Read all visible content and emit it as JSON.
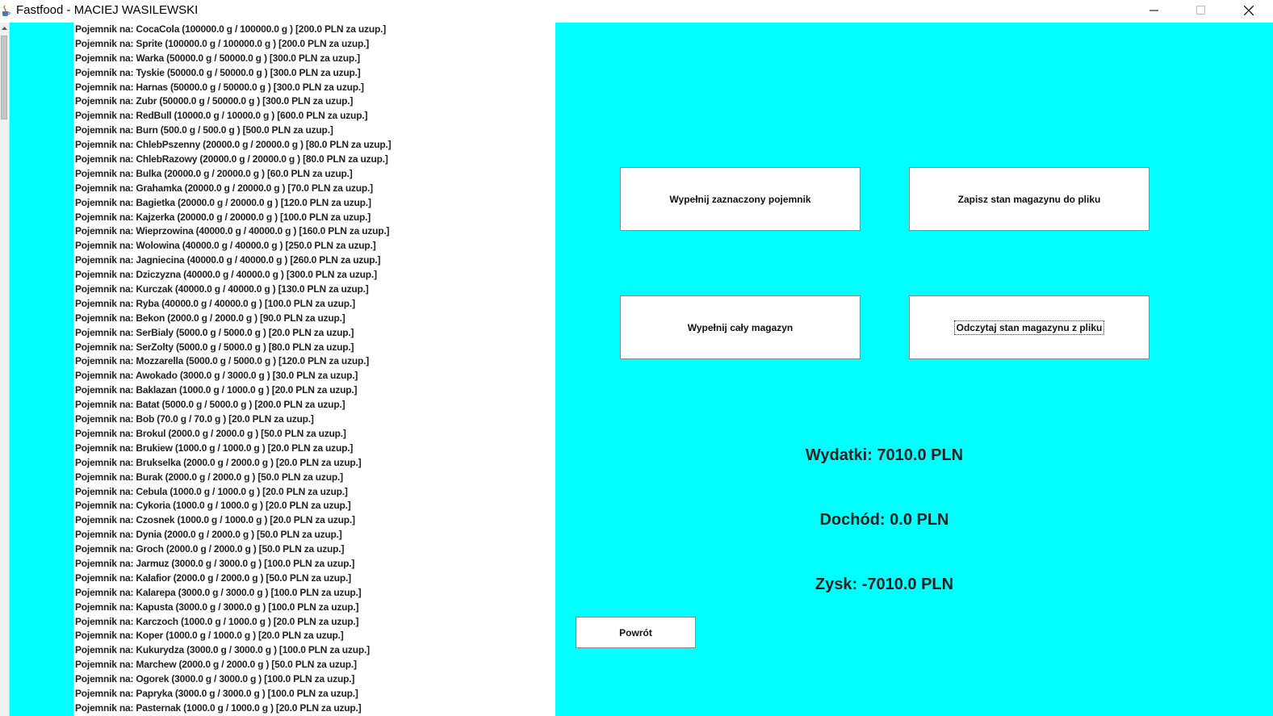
{
  "window": {
    "title": "Fastfood - MACIEJ WASILEWSKI"
  },
  "icons": {
    "app": "java-cup-icon",
    "minimize": "minimize-icon",
    "maximize": "maximize-icon",
    "close": "close-icon",
    "scroll_up": "arrow-up-icon"
  },
  "colors": {
    "panel_background": "#00ffff",
    "list_background": "#ffffff"
  },
  "list": {
    "items": [
      "Pojemnik na: CocaCola (100000.0 g / 100000.0 g ) [200.0 PLN za uzup.]",
      "Pojemnik na: Sprite (100000.0 g / 100000.0 g ) [200.0 PLN za uzup.]",
      "Pojemnik na: Warka (50000.0 g / 50000.0 g ) [300.0 PLN za uzup.]",
      "Pojemnik na: Tyskie (50000.0 g / 50000.0 g ) [300.0 PLN za uzup.]",
      "Pojemnik na: Harnas (50000.0 g / 50000.0 g ) [300.0 PLN za uzup.]",
      "Pojemnik na: Zubr (50000.0 g / 50000.0 g ) [300.0 PLN za uzup.]",
      "Pojemnik na: RedBull (10000.0 g / 10000.0 g ) [600.0 PLN za uzup.]",
      "Pojemnik na: Burn (500.0 g / 500.0 g ) [500.0 PLN za uzup.]",
      "Pojemnik na: ChlebPszenny (20000.0 g / 20000.0 g ) [80.0 PLN za uzup.]",
      "Pojemnik na: ChlebRazowy (20000.0 g / 20000.0 g ) [80.0 PLN za uzup.]",
      "Pojemnik na: Bulka (20000.0 g / 20000.0 g ) [60.0 PLN za uzup.]",
      "Pojemnik na: Grahamka (20000.0 g / 20000.0 g ) [70.0 PLN za uzup.]",
      "Pojemnik na: Bagietka (20000.0 g / 20000.0 g ) [120.0 PLN za uzup.]",
      "Pojemnik na: Kajzerka (20000.0 g / 20000.0 g ) [100.0 PLN za uzup.]",
      "Pojemnik na: Wieprzowina (40000.0 g / 40000.0 g ) [160.0 PLN za uzup.]",
      "Pojemnik na: Wolowina (40000.0 g / 40000.0 g ) [250.0 PLN za uzup.]",
      "Pojemnik na: Jagniecina (40000.0 g / 40000.0 g ) [260.0 PLN za uzup.]",
      "Pojemnik na: Dziczyzna (40000.0 g / 40000.0 g ) [300.0 PLN za uzup.]",
      "Pojemnik na: Kurczak (40000.0 g / 40000.0 g ) [130.0 PLN za uzup.]",
      "Pojemnik na: Ryba (40000.0 g / 40000.0 g ) [100.0 PLN za uzup.]",
      "Pojemnik na: Bekon (2000.0 g / 2000.0 g ) [90.0 PLN za uzup.]",
      "Pojemnik na: SerBialy (5000.0 g / 5000.0 g ) [20.0 PLN za uzup.]",
      "Pojemnik na: SerZolty (5000.0 g / 5000.0 g ) [80.0 PLN za uzup.]",
      "Pojemnik na: Mozzarella (5000.0 g / 5000.0 g ) [120.0 PLN za uzup.]",
      "Pojemnik na: Awokado (3000.0 g / 3000.0 g ) [30.0 PLN za uzup.]",
      "Pojemnik na: Baklazan (1000.0 g / 1000.0 g ) [20.0 PLN za uzup.]",
      "Pojemnik na: Batat (5000.0 g / 5000.0 g ) [200.0 PLN za uzup.]",
      "Pojemnik na: Bob (70.0 g / 70.0 g ) [20.0 PLN za uzup.]",
      "Pojemnik na: Brokul (2000.0 g / 2000.0 g ) [50.0 PLN za uzup.]",
      "Pojemnik na: Brukiew (1000.0 g / 1000.0 g ) [20.0 PLN za uzup.]",
      "Pojemnik na: Brukselka (2000.0 g / 2000.0 g ) [20.0 PLN za uzup.]",
      "Pojemnik na: Burak (2000.0 g / 2000.0 g ) [50.0 PLN za uzup.]",
      "Pojemnik na: Cebula (1000.0 g / 1000.0 g ) [20.0 PLN za uzup.]",
      "Pojemnik na: Cykoria (1000.0 g / 1000.0 g ) [20.0 PLN za uzup.]",
      "Pojemnik na: Czosnek (1000.0 g / 1000.0 g ) [20.0 PLN za uzup.]",
      "Pojemnik na: Dynia (2000.0 g / 2000.0 g ) [50.0 PLN za uzup.]",
      "Pojemnik na: Groch (2000.0 g / 2000.0 g ) [50.0 PLN za uzup.]",
      "Pojemnik na: Jarmuz (3000.0 g / 3000.0 g ) [100.0 PLN za uzup.]",
      "Pojemnik na: Kalafior (2000.0 g / 2000.0 g ) [50.0 PLN za uzup.]",
      "Pojemnik na: Kalarepa (3000.0 g / 3000.0 g ) [100.0 PLN za uzup.]",
      "Pojemnik na: Kapusta (3000.0 g / 3000.0 g ) [100.0 PLN za uzup.]",
      "Pojemnik na: Karczoch (1000.0 g / 1000.0 g ) [20.0 PLN za uzup.]",
      "Pojemnik na: Koper (1000.0 g / 1000.0 g ) [20.0 PLN za uzup.]",
      "Pojemnik na: Kukurydza (3000.0 g / 3000.0 g ) [100.0 PLN za uzup.]",
      "Pojemnik na: Marchew (2000.0 g / 2000.0 g ) [50.0 PLN za uzup.]",
      "Pojemnik na: Ogorek (3000.0 g / 3000.0 g ) [100.0 PLN za uzup.]",
      "Pojemnik na: Papryka (3000.0 g / 3000.0 g ) [100.0 PLN za uzup.]",
      "Pojemnik na: Pasternak (1000.0 g / 1000.0 g ) [20.0 PLN za uzup.]"
    ]
  },
  "buttons": {
    "fill_selected": "Wypełnij zaznaczony pojemnik",
    "save_to_file": "Zapisz stan magazynu do pliku",
    "fill_all": "Wypełnij cały magazyn",
    "read_from_file": "Odczytaj stan magazynu z pliku",
    "back": "Powrót"
  },
  "stats": {
    "expenses": "Wydatki: 7010.0 PLN",
    "income": "Dochód: 0.0 PLN",
    "profit": "Zysk: -7010.0 PLN"
  }
}
